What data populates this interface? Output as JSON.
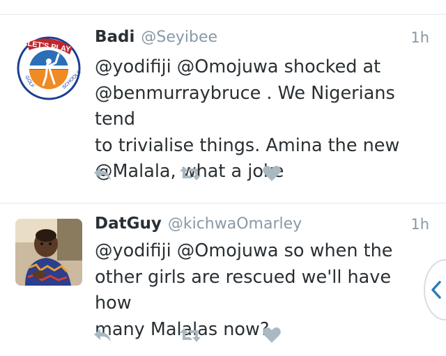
{
  "tweets": [
    {
      "name": "Badi",
      "handle": "@Seyibee",
      "time": "1h",
      "text": "@yodifiji @Omojuwa shocked at\n@benmurraybruce . We Nigerians tend\nto trivialise things. Amina the new\n@Malala, what a joke",
      "avatar_logo_text": "LET'S PLAY GOLF IN SCHOOLS"
    },
    {
      "name": "DatGuy",
      "handle": "@kichwaOmarley",
      "time": "1h",
      "text": "@yodifiji @Omojuwa  so when the\nother girls are rescued we'll have how\nmany Malalas now?"
    }
  ],
  "icons": {
    "reply": "reply-icon",
    "retweet": "retweet-icon",
    "favorite": "heart-icon",
    "side_nav": "chevron-left-icon"
  },
  "colors": {
    "text": "#292f33",
    "muted": "#8899a6",
    "icon": "#aab8c2",
    "separator": "#e1e8ed",
    "accent": "#2b7bb9"
  }
}
